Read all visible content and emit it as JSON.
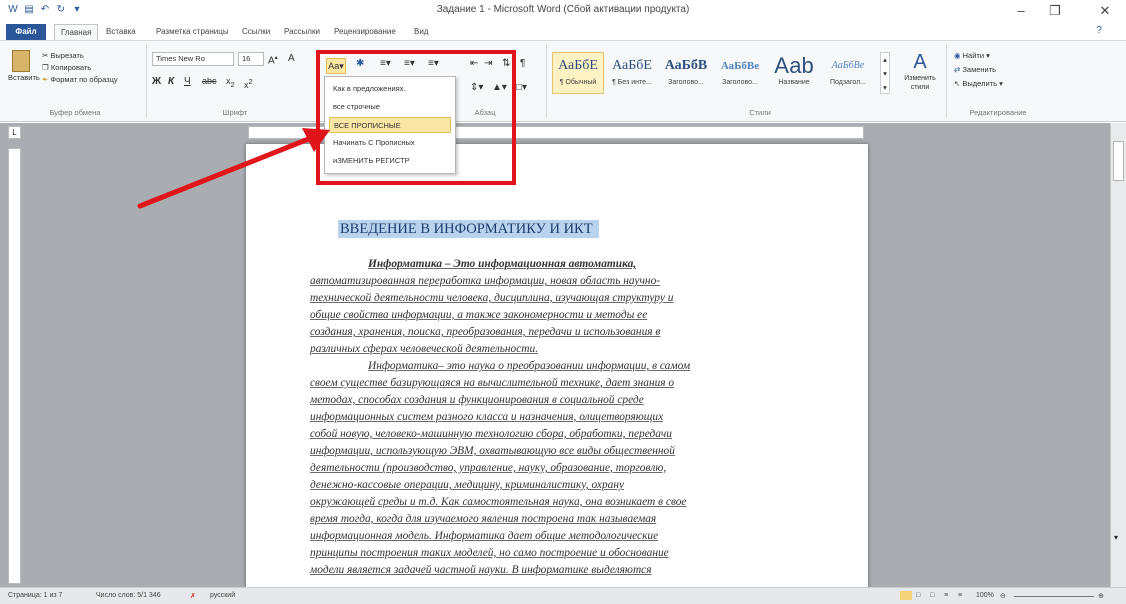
{
  "titlebar": {
    "title": "Задание 1 - Microsoft Word (Сбой активации продукта)"
  },
  "tabs": [
    "Файл",
    "Главная",
    "Вставка",
    "Разметка страницы",
    "Ссылки",
    "Рассылки",
    "Рецензирование",
    "Вид"
  ],
  "clipboard": {
    "paste": "Вставить",
    "cut": "Вырезать",
    "copy": "Копировать",
    "format_painter": "Формат по образцу",
    "group": "Буфер обмена"
  },
  "font": {
    "name": "Times New Ro",
    "size": "16",
    "group": "Шрифт",
    "change_case_label": "Аа"
  },
  "paragraph": {
    "group": "Абзац"
  },
  "styles": {
    "items": [
      {
        "sample": "АаБбЕ",
        "name": "¶ Обычный"
      },
      {
        "sample": "АаБбЕ",
        "name": "¶ Без инте..."
      },
      {
        "sample": "АаБбВ",
        "name": "Заголово..."
      },
      {
        "sample": "АаБбВе",
        "name": "Заголово..."
      },
      {
        "sample": "Ааb",
        "name": "Название"
      },
      {
        "sample": "АаБбВе",
        "name": "Подзагол..."
      }
    ],
    "change_styles": "Изменить стили",
    "group": "Стили"
  },
  "editing": {
    "find": "Найти",
    "replace": "Заменить",
    "select": "Выделить",
    "group": "Редактирование"
  },
  "change_case_menu": [
    "Как в предложениях.",
    "все строчные",
    "ВСЕ ПРОПИСНЫЕ",
    "Начинать С Прописных",
    "иЗМЕНИТЬ РЕГИСТР"
  ],
  "document": {
    "heading": "ВВЕДЕНИЕ В ИНФОРМАТИКУ И ИКТ",
    "lines": [
      "Информатика – Это информационная автоматика,",
      "автоматизированная переработка информации, новая область научно-",
      "технической деятельности человека, дисциплина, изучающая структуру и",
      "общие свойства информации, а также закономерности и методы ее",
      "создания, хранения, поиска, преобразования, передачи и использования в",
      "различных сферах человеческой деятельности.",
      "Информатика– это наука о преобразовании информации, в самом",
      "своем существе базирующаяся на вычислительной технике, дает знания о",
      "методах, способах создания и функционирования в социальной среде",
      "информационных систем разного класса и назначения, олицетворяющих",
      "собой новую, человеко-машинную технологию сбора, обработки, передачи",
      "информации, использующую ЭВМ, охватывающую все виды общественной",
      "деятельности (производство, управление, науку, образование, торговлю,",
      "денежно-кассовые операции, медицину, криминалистику, охрану",
      "окружающей среды и т.д. Как самостоятельная наука, она возникает в свое",
      "время тогда, когда для изучаемого явления построена так называемая",
      "информационная модель. Информатика дает общие методологические",
      "принципы построения таких моделей, но само построение и обоснование",
      "модели является задачей частной науки. В информатике выделяются"
    ]
  },
  "statusbar": {
    "page": "Страница: 1 из 7",
    "words": "Число слов: 5/1 346",
    "language": "русский",
    "zoom": "100%"
  },
  "colors": {
    "accent": "#2b579a",
    "highlight_box": "#e0141b",
    "selection": "#b9d3ef",
    "menu_hover": "#fbe6a6"
  }
}
